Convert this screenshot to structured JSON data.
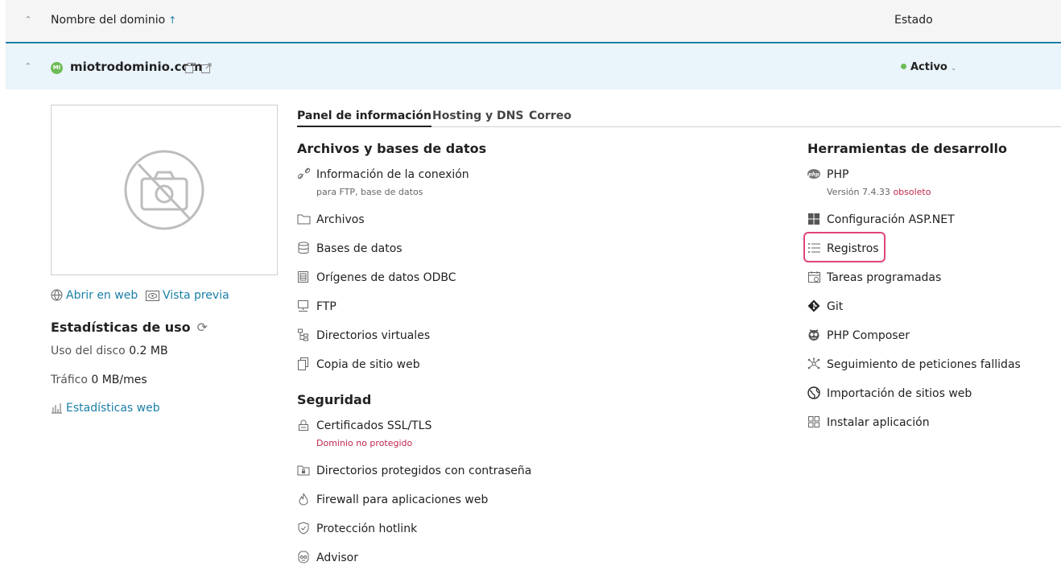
{
  "header": {
    "column_name": "Nombre del dominio",
    "sort_icon": "arrow-up-icon",
    "column_status": "Estado"
  },
  "domain": {
    "avatar_initials": "MI",
    "name": "miotrodominio.com",
    "status": "Activo",
    "status_color": "#6dbb55"
  },
  "sidebar": {
    "open_web": "Abrir en web",
    "preview": "Vista previa",
    "stats_title": "Estadísticas de uso",
    "disk_label": "Uso del disco",
    "disk_value": "0.2 MB",
    "traffic_label": "Tráfico",
    "traffic_value": "0 MB/mes",
    "web_stats": "Estadísticas web"
  },
  "tabs": [
    {
      "label": "Panel de información",
      "active": true
    },
    {
      "label": "Hosting y DNS",
      "active": false
    },
    {
      "label": "Correo",
      "active": false
    }
  ],
  "files_section": {
    "title": "Archivos y bases de datos",
    "items": [
      {
        "label": "Información de la conexión",
        "sub": "para FTP, base de datos",
        "icon": "link-icon"
      },
      {
        "label": "Archivos",
        "icon": "folder-icon"
      },
      {
        "label": "Bases de datos",
        "icon": "database-icon"
      },
      {
        "label": "Orígenes de datos ODBC",
        "icon": "odbc-icon"
      },
      {
        "label": "FTP",
        "icon": "ftp-icon"
      },
      {
        "label": "Directorios virtuales",
        "icon": "sitemap-icon"
      },
      {
        "label": "Copia de sitio web",
        "icon": "copy-icon"
      }
    ]
  },
  "security_section": {
    "title": "Seguridad",
    "items": [
      {
        "label": "Certificados SSL/TLS",
        "sub": "Dominio no protegido",
        "icon": "lock-icon"
      },
      {
        "label": "Directorios protegidos con contraseña",
        "icon": "protected-folder-icon"
      },
      {
        "label": "Firewall para aplicaciones web",
        "icon": "fire-icon"
      },
      {
        "label": "Protección hotlink",
        "icon": "shield-icon"
      },
      {
        "label": "Advisor",
        "icon": "advisor-icon"
      }
    ]
  },
  "dev_section": {
    "title": "Herramientas de desarrollo",
    "php_version_label": "Versión 7.4.33",
    "php_version_status": "obsoleto",
    "items": [
      {
        "label": "PHP",
        "icon": "php-icon"
      },
      {
        "label": "Configuración ASP.NET",
        "icon": "windows-icon"
      },
      {
        "label": "Registros",
        "icon": "list-icon"
      },
      {
        "label": "Tareas programadas",
        "icon": "calendar-icon"
      },
      {
        "label": "Git",
        "icon": "git-icon"
      },
      {
        "label": "PHP Composer",
        "icon": "composer-icon"
      },
      {
        "label": "Seguimiento de peticiones fallidas",
        "icon": "network-icon"
      },
      {
        "label": "Importación de sitios web",
        "icon": "globe-import-icon"
      },
      {
        "label": "Instalar aplicación",
        "icon": "apps-icon"
      }
    ]
  }
}
